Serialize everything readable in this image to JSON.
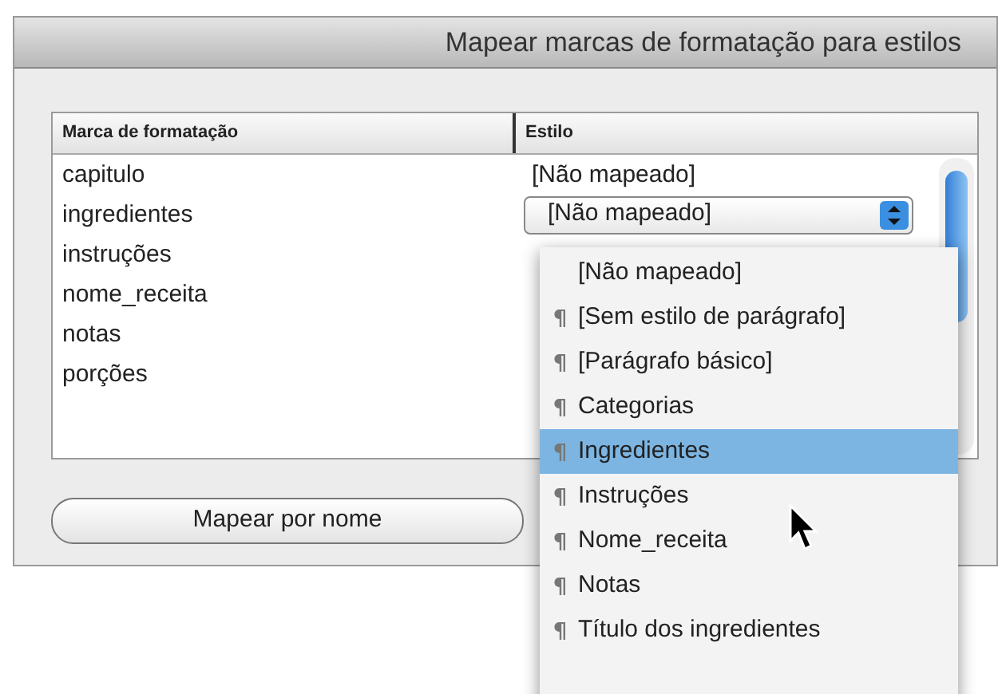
{
  "window": {
    "title": "Mapear marcas de formatação para estilos"
  },
  "table": {
    "columns": [
      "Marca de formatação",
      "Estilo"
    ],
    "rows": [
      {
        "mark": "capitulo",
        "style": "[Não mapeado]",
        "kind": "text"
      },
      {
        "mark": "ingredientes",
        "style": "[Não mapeado]",
        "kind": "dropdown"
      },
      {
        "mark": "instruções",
        "kind": "none"
      },
      {
        "mark": "nome_receita",
        "kind": "none"
      },
      {
        "mark": "notas",
        "kind": "none"
      },
      {
        "mark": "porções",
        "kind": "none"
      }
    ]
  },
  "dropdown_menu": {
    "items": [
      {
        "label": "[Não mapeado]",
        "kind": "plain",
        "selected": false
      },
      {
        "label": "[Sem estilo de parágrafo]",
        "kind": "paragraph",
        "selected": false
      },
      {
        "label": "[Parágrafo básico]",
        "kind": "paragraph",
        "selected": false
      },
      {
        "label": "Categorias",
        "kind": "paragraph",
        "selected": false
      },
      {
        "label": "Ingredientes",
        "kind": "paragraph",
        "selected": true
      },
      {
        "label": "Instruções",
        "kind": "paragraph",
        "selected": false
      },
      {
        "label": "Nome_receita",
        "kind": "paragraph",
        "selected": false
      },
      {
        "label": "Notas",
        "kind": "paragraph",
        "selected": false
      },
      {
        "label": "Título dos ingredientes",
        "kind": "paragraph",
        "selected": false
      }
    ]
  },
  "buttons": [
    "Mapear por nome"
  ]
}
